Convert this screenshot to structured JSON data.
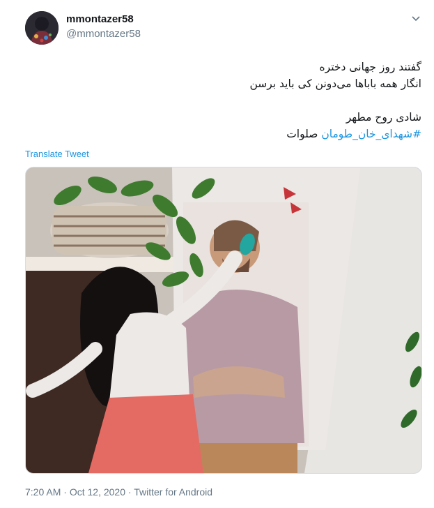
{
  "user": {
    "display_name": "mmontazer58",
    "handle": "@mmontazer58",
    "avatar_icon": "avatar-photo"
  },
  "menu_icon": "chevron-down-icon",
  "tweet": {
    "lines": [
      "گفتند  روز جهانی دختره",
      "انگار همه باباها می‌دونن کی باید برسن"
    ],
    "line3": "شادی روح مطهر",
    "hashtag": "#شهدای_خان_طومان",
    "line4_suffix": " صلوات",
    "translate": "Translate Tweet"
  },
  "meta": {
    "time": "7:20 AM",
    "sep1": " · ",
    "date": "Oct 12, 2020",
    "sep2": " · ",
    "source": "Twitter for Android"
  },
  "colors": {
    "link": "#1b95e0",
    "secondary": "#657786",
    "text": "#14171a"
  }
}
